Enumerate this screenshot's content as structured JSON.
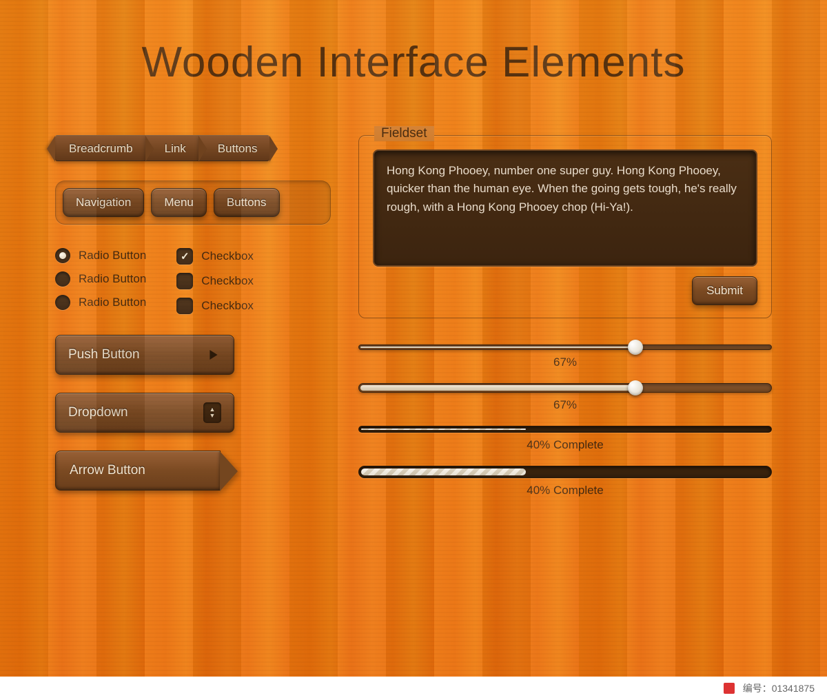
{
  "title": "Wooden Interface Elements",
  "breadcrumb": [
    "Breadcrumb",
    "Link",
    "Buttons"
  ],
  "nav": [
    "Navigation",
    "Menu",
    "Buttons"
  ],
  "radios": [
    {
      "label": "Radio Button",
      "selected": true
    },
    {
      "label": "Radio Button",
      "selected": false
    },
    {
      "label": "Radio Button",
      "selected": false
    }
  ],
  "checkboxes": [
    {
      "label": "Checkbox",
      "checked": true
    },
    {
      "label": "Checkbox",
      "checked": false
    },
    {
      "label": "Checkbox",
      "checked": false
    }
  ],
  "push_button_label": "Push Button",
  "dropdown_label": "Dropdown",
  "arrow_button_label": "Arrow Button",
  "fieldset": {
    "legend": "Fieldset",
    "text": "Hong Kong Phooey, number one super guy. Hong Kong Phooey, quicker than the human eye. When the going gets tough, he's really rough, with a Hong Kong Phooey chop (Hi-Ya!).",
    "submit": "Submit"
  },
  "sliders": [
    {
      "percent": 67,
      "label": "67%"
    },
    {
      "percent": 67,
      "label": "67%"
    }
  ],
  "progress": [
    {
      "percent": 40,
      "label": "40% Complete"
    },
    {
      "percent": 40,
      "label": "40% Complete"
    }
  ],
  "footer": {
    "asset_id": "编号：01341875"
  }
}
